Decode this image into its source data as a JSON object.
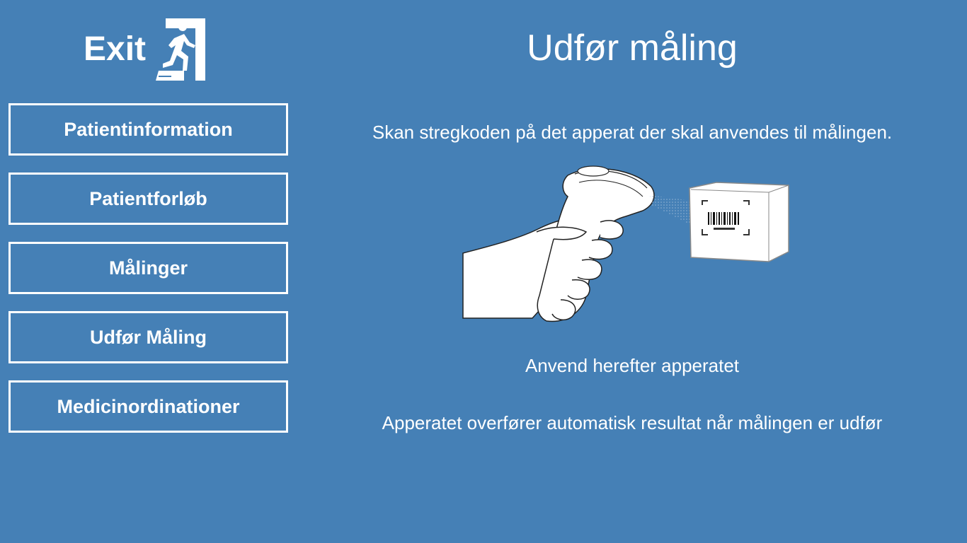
{
  "header": {
    "exit_label": "Exit"
  },
  "nav": {
    "items": [
      {
        "label": "Patientinformation"
      },
      {
        "label": "Patientforløb"
      },
      {
        "label": "Målinger"
      },
      {
        "label": "Udfør Måling"
      },
      {
        "label": "Medicinordinationer"
      }
    ]
  },
  "main": {
    "title": "Udfør måling",
    "scan_instruction": "Skan stregkoden på det apperat der skal anvendes til målingen.",
    "use_instruction": "Anvend herefter apperatet",
    "auto_instruction": "Apperatet overfører automatisk resultat når målingen er udfør",
    "illustration_icon": "barcode-scanner-illustration"
  },
  "colors": {
    "background": "#4580b6",
    "foreground": "#ffffff"
  }
}
